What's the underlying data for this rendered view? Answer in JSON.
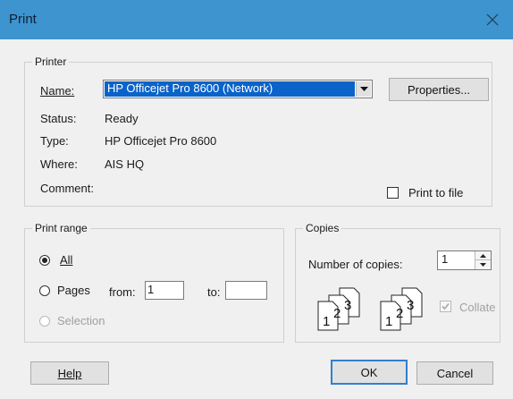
{
  "window": {
    "title": "Print",
    "close_icon": "close-icon"
  },
  "printer": {
    "group_label": "Printer",
    "name_label": "Name:",
    "name_value": "HP Officejet Pro 8600 (Network)",
    "properties_label": "Properties...",
    "status_label": "Status:",
    "status_value": "Ready",
    "type_label": "Type:",
    "type_value": "HP Officejet Pro 8600",
    "where_label": "Where:",
    "where_value": "AIS HQ",
    "comment_label": "Comment:",
    "comment_value": "",
    "print_to_file_label": "Print to file",
    "print_to_file_checked": false
  },
  "print_range": {
    "group_label": "Print range",
    "all_label": "All",
    "pages_label": "Pages",
    "from_label": "from:",
    "from_value": "1",
    "to_label": "to:",
    "to_value": "",
    "selection_label": "Selection",
    "selected": "all"
  },
  "copies": {
    "group_label": "Copies",
    "number_label": "Number of copies:",
    "number_value": "1",
    "collate_label": "Collate",
    "collate_checked": true,
    "collate_enabled": false,
    "collate_page_numbers": [
      "1",
      "2",
      "3"
    ]
  },
  "footer": {
    "help_label": "Help",
    "ok_label": "OK",
    "cancel_label": "Cancel"
  }
}
